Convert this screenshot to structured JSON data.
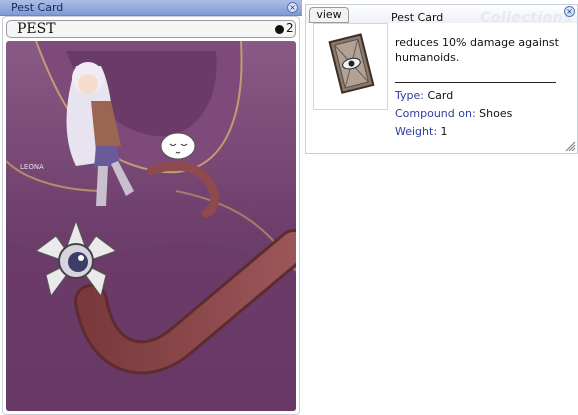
{
  "card_window": {
    "title": "Pest Card",
    "card_name": "PEST",
    "slot_count": "2"
  },
  "info_window": {
    "tab_label": "view",
    "title": "Pest Card",
    "watermark": "Collections",
    "description": "reduces 10% damage against humanoids.",
    "type_label": "Type:",
    "type_value": "Card",
    "compound_label": "Compound on:",
    "compound_value": "Shoes",
    "weight_label": "Weight:",
    "weight_value": "1"
  },
  "artwork": {
    "signature": "LEONA"
  },
  "colors": {
    "titlebar": "#8ea6dc",
    "art_background": "#7a4a78",
    "label_blue": "#2a3fa0"
  },
  "icons": [
    "close-icon",
    "close-icon",
    "resize-grip-icon",
    "eye-card-item-icon"
  ]
}
